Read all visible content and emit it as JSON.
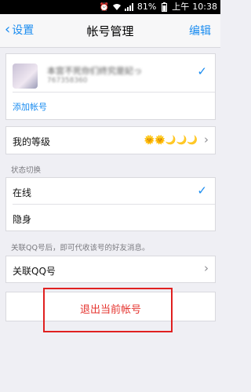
{
  "status_bar": {
    "battery_percent": "81%",
    "period": "上午",
    "time": "10:38"
  },
  "nav": {
    "back_label": "设置",
    "title": "帐号管理",
    "edit_label": "编辑"
  },
  "account": {
    "nickname": "本宫不死你们终究是妃っ",
    "qq_number": "767358360",
    "add_account_label": "添加帐号"
  },
  "level": {
    "label": "我的等级",
    "icons": "🌞🌞🌙🌙🌙"
  },
  "status_switch": {
    "header": "状态切换",
    "options": [
      {
        "label": "在线",
        "selected": true
      },
      {
        "label": "隐身",
        "selected": false
      }
    ]
  },
  "linked_qq": {
    "hint": "关联QQ号后，即可代收该号的好友消息。",
    "label": "关联QQ号"
  },
  "logout": {
    "label": "退出当前帐号"
  }
}
